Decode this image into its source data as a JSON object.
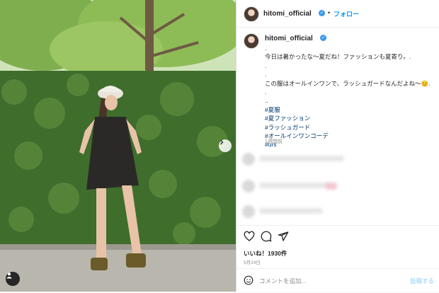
{
  "header": {
    "username": "hitomi_official",
    "separator": "•",
    "follow_label": "フォロー"
  },
  "caption": {
    "username": "hitomi_official",
    "lines": [
      ".",
      "今日は暑かったな〜夏だね！ファッションも夏寄り。.",
      ".",
      ".",
      "この服はオールインワンで、ラッシュガードなんだよね〜😊.",
      ".",
      ".."
    ],
    "hashtags": [
      "#夏服",
      "#夏ファッション",
      "#ラッシュガード",
      "#オールインワンコーデ",
      "#urs"
    ],
    "time_ago": "1週間前"
  },
  "actions": {
    "icons": [
      "heart-icon",
      "comment-icon",
      "share-icon"
    ],
    "likes": "いいね！1930件",
    "date": "5月24日"
  },
  "comment": {
    "placeholder": "コメントを追加...",
    "post_label": "投稿する"
  },
  "colors": {
    "link": "#0095f6",
    "hashtag": "#00376b",
    "verified": "#3897f0",
    "muted": "#8e8e8e"
  }
}
